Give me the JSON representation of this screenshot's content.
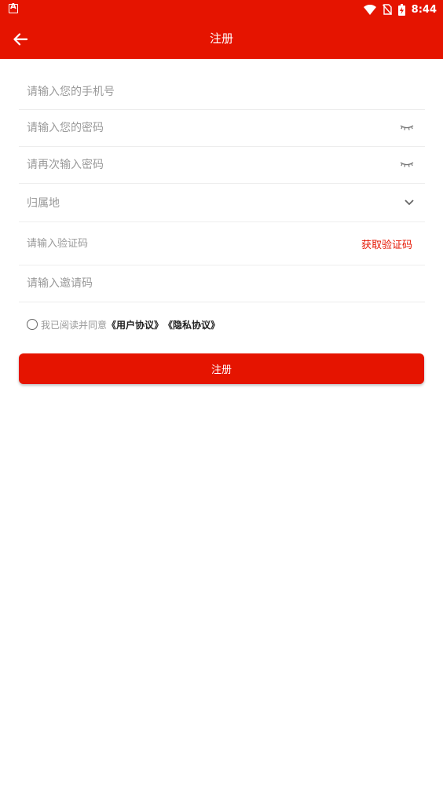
{
  "status_bar": {
    "time": "8:44"
  },
  "header": {
    "title": "注册",
    "back_icon": "arrow-left-icon"
  },
  "form": {
    "phone_placeholder": "请输入您的手机号",
    "password_placeholder": "请输入您的密码",
    "confirm_placeholder": "请再次输入密码",
    "region_label": "归属地",
    "code_placeholder": "请输入验证码",
    "get_code_label": "获取验证码",
    "invite_placeholder": "请输入邀请码"
  },
  "agreement": {
    "prefix": "我已阅读并同意",
    "user_agreement": "《用户协议》",
    "privacy_policy": "《隐私协议》"
  },
  "submit_label": "注册",
  "colors": {
    "primary": "#e51400",
    "placeholder": "#9a9a9a",
    "divider": "#ededed"
  }
}
